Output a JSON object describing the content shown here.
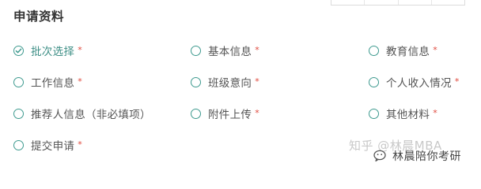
{
  "section": {
    "title": "申请资料"
  },
  "steps": [
    {
      "label": "批次选择",
      "required_mark": "*",
      "state": "done"
    },
    {
      "label": "基本信息",
      "required_mark": "*",
      "state": "pending"
    },
    {
      "label": "教育信息",
      "required_mark": "*",
      "state": "pending"
    },
    {
      "label": "工作信息",
      "required_mark": "*",
      "state": "pending"
    },
    {
      "label": "班级意向",
      "required_mark": "*",
      "state": "pending"
    },
    {
      "label": "个人收入情况",
      "required_mark": "*",
      "state": "pending"
    },
    {
      "label": "推荐人信息（非必填项）",
      "required_mark": "",
      "state": "pending"
    },
    {
      "label": "附件上传",
      "required_mark": "*",
      "state": "pending"
    },
    {
      "label": "其他材料",
      "required_mark": "*",
      "state": "pending"
    },
    {
      "label": "提交申请",
      "required_mark": "*",
      "state": "pending"
    }
  ],
  "watermark": {
    "line1": "知乎 @林晨MBA",
    "line2": "林晨陪你考研",
    "icon": "wechat-icon"
  },
  "colors": {
    "accent": "#3e9a8f",
    "required": "#e0473b",
    "text": "#555555",
    "title": "#333333"
  }
}
